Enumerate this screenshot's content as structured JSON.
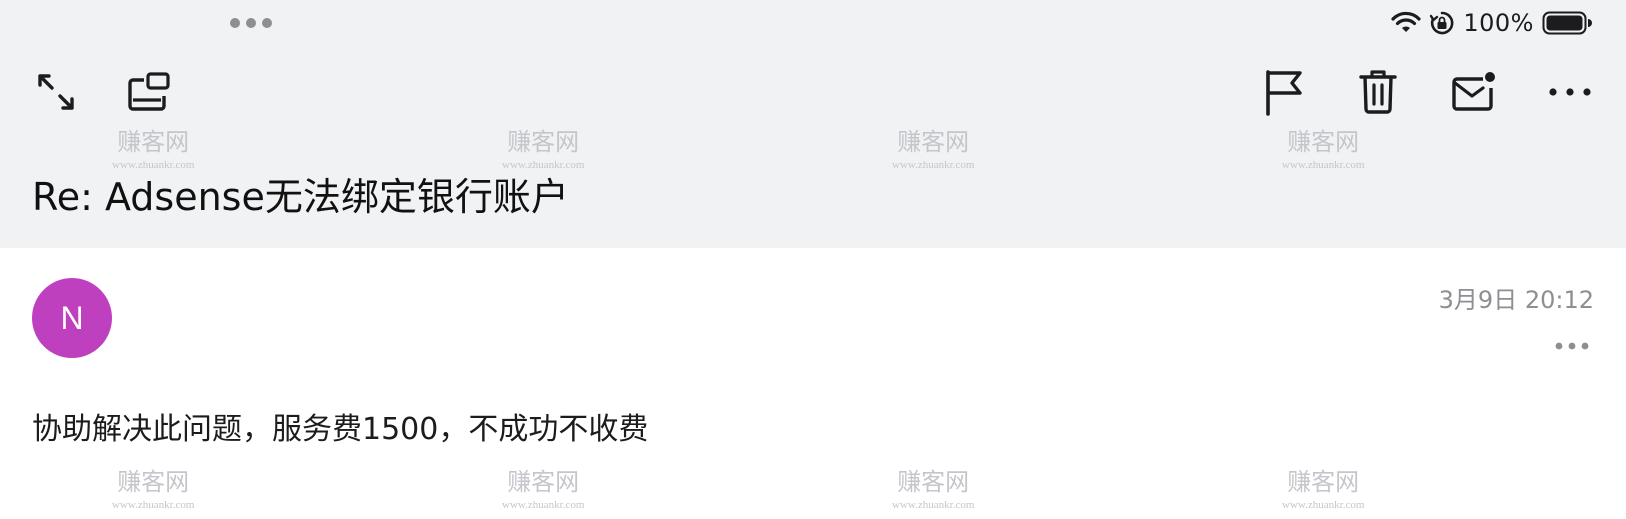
{
  "status_bar": {
    "battery_percent": "100%",
    "icons": [
      "wifi-icon",
      "orientation-lock-icon",
      "battery-icon"
    ],
    "battery_level": 1.0
  },
  "toolbar": {
    "left": [
      "expand-icon",
      "window-icon"
    ],
    "right": [
      "flag-icon",
      "trash-icon",
      "mail-unread-icon",
      "more-icon"
    ]
  },
  "email": {
    "subject": "Re: Adsense无法绑定银行账户",
    "sender_initial": "N",
    "avatar_color": "#bf40bf",
    "date": "3月9日 20:12",
    "body": "协助解决此问题，服务费1500，不成功不收费"
  },
  "watermark": {
    "name": "赚客网",
    "url": "www.zhuankr.com"
  },
  "colors": {
    "header_bg": "#f1f2f4",
    "secondary_text": "#8e8e93"
  }
}
